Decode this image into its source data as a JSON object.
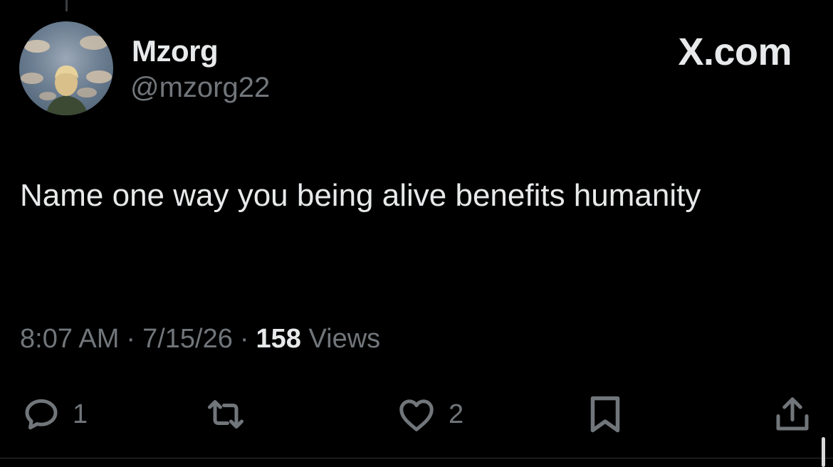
{
  "author": {
    "display_name": "Mzorg",
    "handle": "@mzorg22"
  },
  "brand": {
    "label": "X.com"
  },
  "tweet": {
    "text": "Name one way you being alive benefits humanity"
  },
  "meta": {
    "time": "8:07 AM",
    "separator": "·",
    "date": "7/15/26",
    "views_count": "158",
    "views_label": "Views"
  },
  "actions": {
    "reply_count": "1",
    "like_count": "2",
    "reply_icon": "reply-bubble-icon",
    "retweet_icon": "retweet-icon",
    "like_icon": "heart-icon",
    "bookmark_icon": "bookmark-icon",
    "share_icon": "share-icon"
  },
  "colors": {
    "background": "#000000",
    "primary_text": "#e7e9ea",
    "secondary_text": "#71767b"
  }
}
